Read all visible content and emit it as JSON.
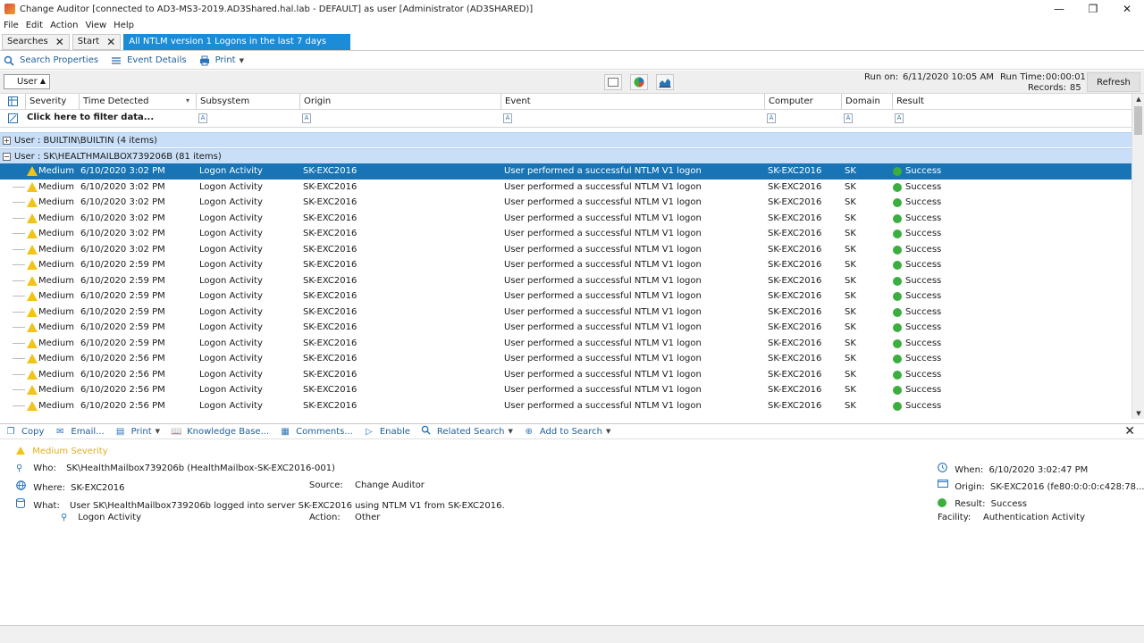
{
  "window": {
    "title": "Change Auditor [connected to AD3-MS3-2019.AD3Shared.hal.lab - DEFAULT] as user [Administrator (AD3SHARED)]",
    "minimize": "—",
    "maximize": "❐",
    "close": "✕"
  },
  "menu": [
    "File",
    "Edit",
    "Action",
    "View",
    "Help"
  ],
  "tabs": [
    {
      "label": "Searches",
      "close": "✕"
    },
    {
      "label": "Start",
      "close": "✕"
    },
    {
      "label": "All NTLM version 1 Logons in the last 7 days"
    }
  ],
  "toolbar": {
    "search_properties": "Search Properties",
    "event_details": "Event Details",
    "print": "Print"
  },
  "groupbar": {
    "group_by": "User",
    "run_on_label": "Run on:",
    "run_on_value": "6/11/2020 10:05 AM",
    "run_time_label": "Run Time:",
    "run_time_value": "00:00:01",
    "records_label": "Records:",
    "records_value": "85",
    "refresh": "Refresh"
  },
  "columns": [
    "Severity",
    "Time Detected",
    "Subsystem",
    "Origin",
    "Event",
    "Computer",
    "Domain",
    "Result"
  ],
  "filter_text": "Click here to filter data...",
  "filter_icon": "A",
  "groups": [
    {
      "toggle": "+",
      "label": "User : BUILTIN\\BUILTIN (4 items)"
    },
    {
      "toggle": "−",
      "label": "User : SK\\HEALTHMAILBOX739206B (81 items)"
    }
  ],
  "rows": [
    {
      "severity": "Medium",
      "time": "6/10/2020 3:02 PM",
      "subsystem": "Logon Activity",
      "origin": "SK-EXC2016",
      "event": "User performed a successful NTLM V1 logon",
      "computer": "SK-EXC2016",
      "domain": "SK",
      "result": "Success"
    },
    {
      "severity": "Medium",
      "time": "6/10/2020 3:02 PM",
      "subsystem": "Logon Activity",
      "origin": "SK-EXC2016",
      "event": "User performed a successful NTLM V1 logon",
      "computer": "SK-EXC2016",
      "domain": "SK",
      "result": "Success"
    },
    {
      "severity": "Medium",
      "time": "6/10/2020 3:02 PM",
      "subsystem": "Logon Activity",
      "origin": "SK-EXC2016",
      "event": "User performed a successful NTLM V1 logon",
      "computer": "SK-EXC2016",
      "domain": "SK",
      "result": "Success"
    },
    {
      "severity": "Medium",
      "time": "6/10/2020 3:02 PM",
      "subsystem": "Logon Activity",
      "origin": "SK-EXC2016",
      "event": "User performed a successful NTLM V1 logon",
      "computer": "SK-EXC2016",
      "domain": "SK",
      "result": "Success"
    },
    {
      "severity": "Medium",
      "time": "6/10/2020 3:02 PM",
      "subsystem": "Logon Activity",
      "origin": "SK-EXC2016",
      "event": "User performed a successful NTLM V1 logon",
      "computer": "SK-EXC2016",
      "domain": "SK",
      "result": "Success"
    },
    {
      "severity": "Medium",
      "time": "6/10/2020 3:02 PM",
      "subsystem": "Logon Activity",
      "origin": "SK-EXC2016",
      "event": "User performed a successful NTLM V1 logon",
      "computer": "SK-EXC2016",
      "domain": "SK",
      "result": "Success"
    },
    {
      "severity": "Medium",
      "time": "6/10/2020 2:59 PM",
      "subsystem": "Logon Activity",
      "origin": "SK-EXC2016",
      "event": "User performed a successful NTLM V1 logon",
      "computer": "SK-EXC2016",
      "domain": "SK",
      "result": "Success"
    },
    {
      "severity": "Medium",
      "time": "6/10/2020 2:59 PM",
      "subsystem": "Logon Activity",
      "origin": "SK-EXC2016",
      "event": "User performed a successful NTLM V1 logon",
      "computer": "SK-EXC2016",
      "domain": "SK",
      "result": "Success"
    },
    {
      "severity": "Medium",
      "time": "6/10/2020 2:59 PM",
      "subsystem": "Logon Activity",
      "origin": "SK-EXC2016",
      "event": "User performed a successful NTLM V1 logon",
      "computer": "SK-EXC2016",
      "domain": "SK",
      "result": "Success"
    },
    {
      "severity": "Medium",
      "time": "6/10/2020 2:59 PM",
      "subsystem": "Logon Activity",
      "origin": "SK-EXC2016",
      "event": "User performed a successful NTLM V1 logon",
      "computer": "SK-EXC2016",
      "domain": "SK",
      "result": "Success"
    },
    {
      "severity": "Medium",
      "time": "6/10/2020 2:59 PM",
      "subsystem": "Logon Activity",
      "origin": "SK-EXC2016",
      "event": "User performed a successful NTLM V1 logon",
      "computer": "SK-EXC2016",
      "domain": "SK",
      "result": "Success"
    },
    {
      "severity": "Medium",
      "time": "6/10/2020 2:59 PM",
      "subsystem": "Logon Activity",
      "origin": "SK-EXC2016",
      "event": "User performed a successful NTLM V1 logon",
      "computer": "SK-EXC2016",
      "domain": "SK",
      "result": "Success"
    },
    {
      "severity": "Medium",
      "time": "6/10/2020 2:56 PM",
      "subsystem": "Logon Activity",
      "origin": "SK-EXC2016",
      "event": "User performed a successful NTLM V1 logon",
      "computer": "SK-EXC2016",
      "domain": "SK",
      "result": "Success"
    },
    {
      "severity": "Medium",
      "time": "6/10/2020 2:56 PM",
      "subsystem": "Logon Activity",
      "origin": "SK-EXC2016",
      "event": "User performed a successful NTLM V1 logon",
      "computer": "SK-EXC2016",
      "domain": "SK",
      "result": "Success"
    },
    {
      "severity": "Medium",
      "time": "6/10/2020 2:56 PM",
      "subsystem": "Logon Activity",
      "origin": "SK-EXC2016",
      "event": "User performed a successful NTLM V1 logon",
      "computer": "SK-EXC2016",
      "domain": "SK",
      "result": "Success"
    },
    {
      "severity": "Medium",
      "time": "6/10/2020 2:56 PM",
      "subsystem": "Logon Activity",
      "origin": "SK-EXC2016",
      "event": "User performed a successful NTLM V1 logon",
      "computer": "SK-EXC2016",
      "domain": "SK",
      "result": "Success"
    }
  ],
  "detail_toolbar": {
    "copy": "Copy",
    "email": "Email...",
    "print": "Print",
    "knowledge_base": "Knowledge Base...",
    "comments": "Comments...",
    "enable": "Enable",
    "related_search": "Related Search",
    "add_to_search": "Add to Search",
    "close": "✕"
  },
  "details": {
    "severity": "Medium Severity",
    "who_label": "Who:",
    "who_value": "SK\\HealthMailbox739206b  (HealthMailbox-SK-EXC2016-001)",
    "where_label": "Where:",
    "where_value": "SK-EXC2016",
    "source_label": "Source:",
    "source_value": "Change Auditor",
    "what_label": "What:",
    "what_value": "User SK\\HealthMailbox739206b logged into server SK-EXC2016 using NTLM V1 from SK-EXC2016.",
    "subsystem": "Logon Activity",
    "action_label": "Action:",
    "action_value": "Other",
    "when_label": "When:",
    "when_value": "6/10/2020 3:02:47 PM",
    "origin_label": "Origin:",
    "origin_value": "SK-EXC2016  (fe80:0:0:0:c428:78...",
    "result_label": "Result:",
    "result_value": "Success",
    "facility_label": "Facility:",
    "facility_value": "Authentication Activity"
  },
  "colors": {
    "selected_row": "#1874b5",
    "group_row": "#c9dff7",
    "active_tab": "#1d8cd6",
    "warning": "#f2c318",
    "success": "#3cae3f",
    "link": "#1f5f99"
  }
}
